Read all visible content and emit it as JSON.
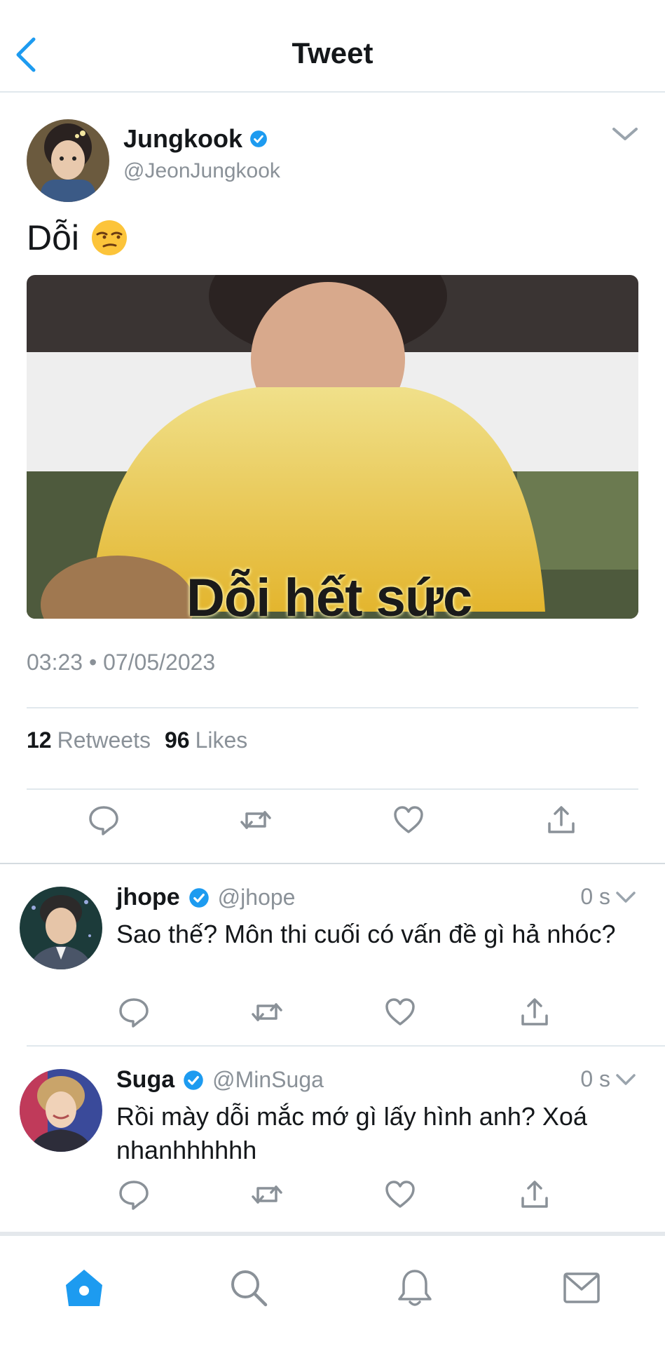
{
  "header": {
    "title": "Tweet",
    "back_icon": "chevron-left-icon"
  },
  "tweet": {
    "author_name": "Jungkook",
    "author_handle": "@JeonJungkook",
    "text": "Dỗi",
    "emoji": "unamused-face",
    "media_caption": "Dỗi hết sức",
    "timestamp": "03:23 • 07/05/2023",
    "retweets_count": "12",
    "retweets_label": "Retweets",
    "likes_count": "96",
    "likes_label": "Likes"
  },
  "replies": [
    {
      "name": "jhope",
      "handle": "@jhope",
      "time": "0 s",
      "text": "Sao thế? Môn thi cuối có vấn đề gì hả nhóc?"
    },
    {
      "name": "Suga",
      "handle": "@MinSuga",
      "time": "0 s",
      "text": "Rồi mày dỗi mắc mớ gì lấy hình anh? Xoá nhanhhhhhh"
    }
  ],
  "colors": {
    "accent": "#1d9bf0",
    "muted": "#8a9198",
    "verified": "#1d9bf0"
  },
  "tabbar": [
    "home-icon",
    "search-icon",
    "bell-icon",
    "mail-icon"
  ]
}
